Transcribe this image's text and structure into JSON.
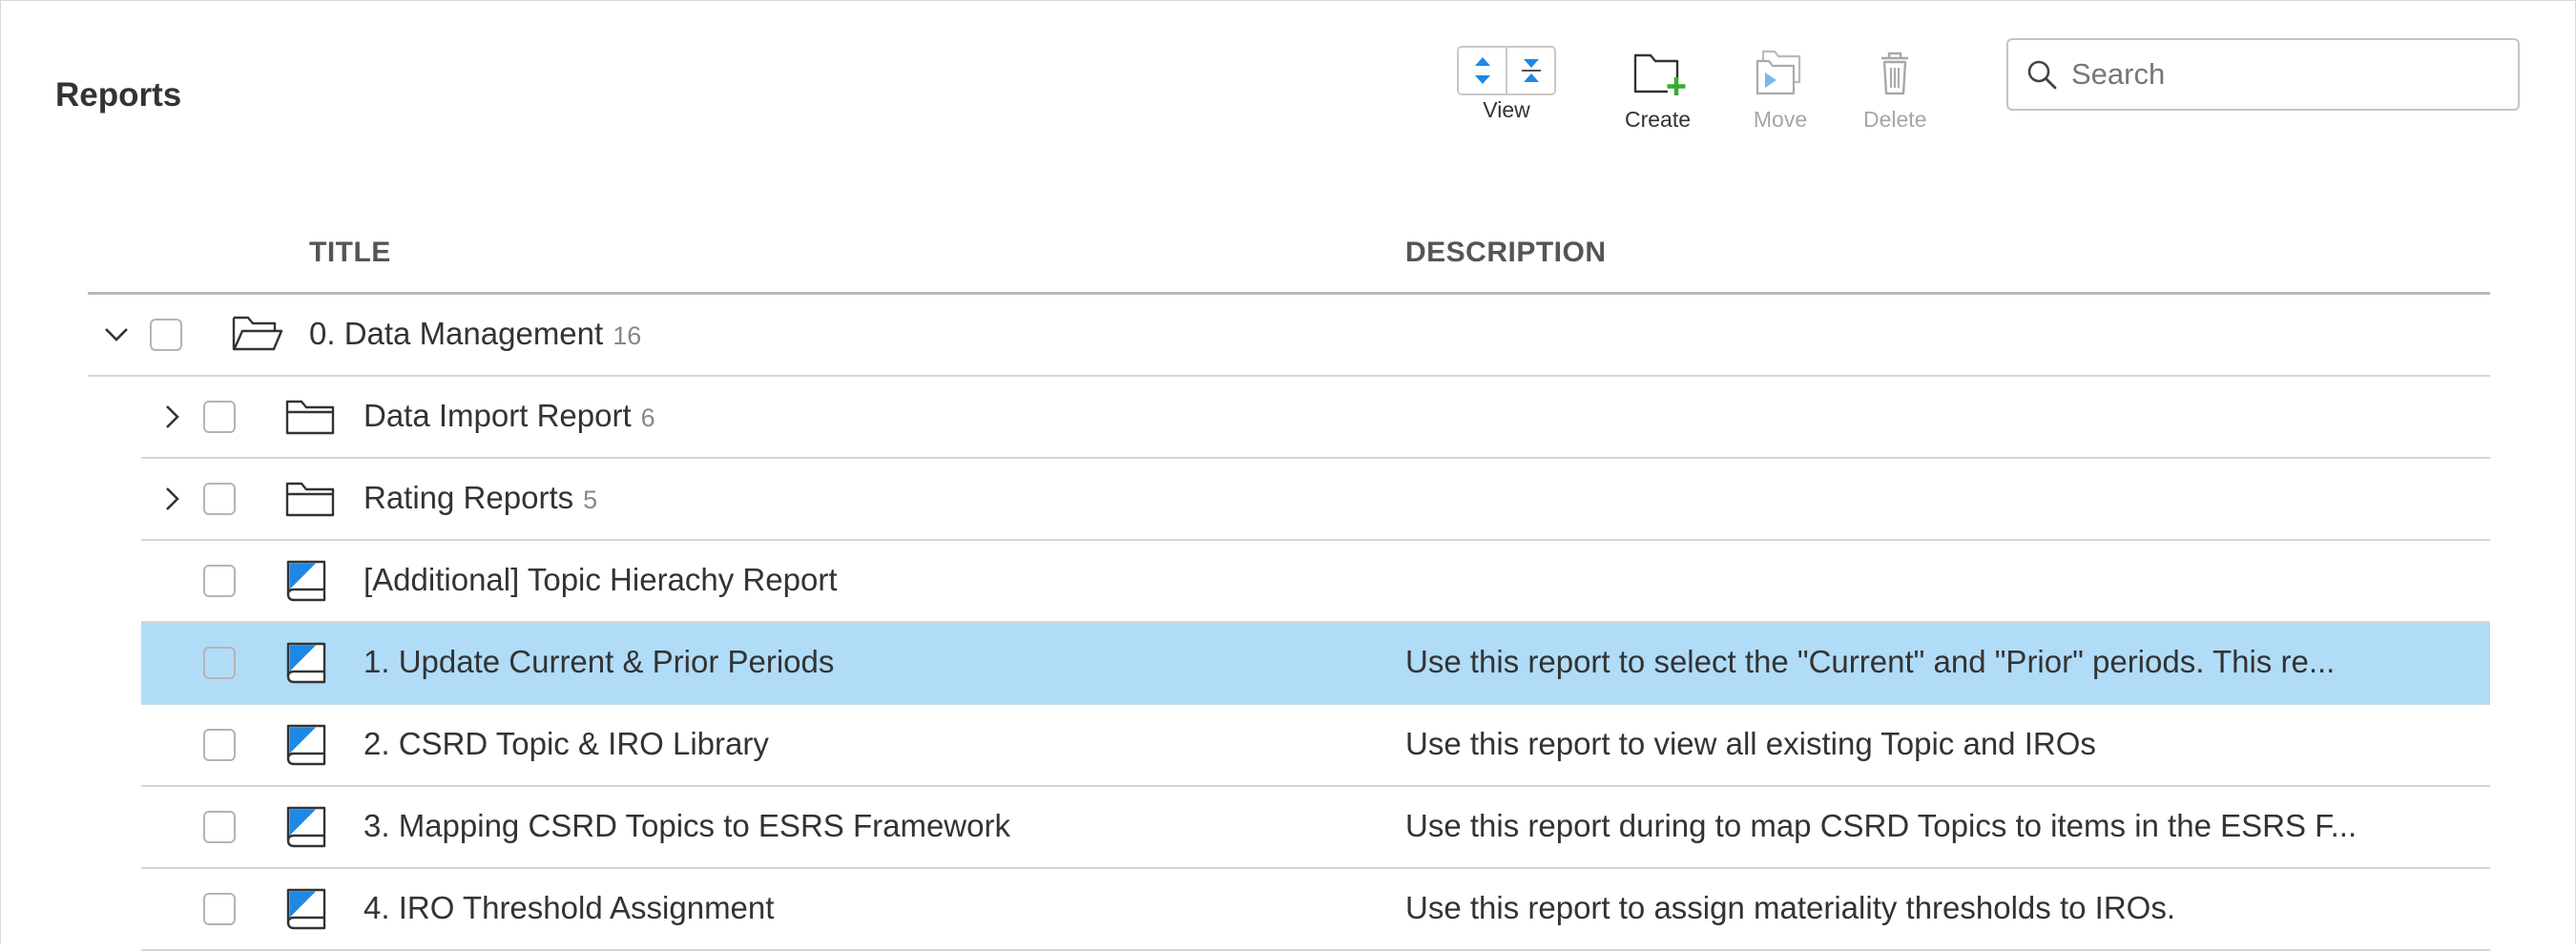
{
  "page": {
    "title": "Reports"
  },
  "toolbar": {
    "view_label": "View",
    "create_label": "Create",
    "move_label": "Move",
    "delete_label": "Delete"
  },
  "search": {
    "placeholder": "Search",
    "value": ""
  },
  "columns": {
    "title": "TITLE",
    "description": "DESCRIPTION"
  },
  "colors": {
    "selected_row": "#b0dcf8",
    "accent_blue": "#1e88e5",
    "create_green": "#3aaa35"
  },
  "rows": [
    {
      "type": "folder",
      "expanded": true,
      "title": "0. Data Management",
      "count": "16",
      "description": ""
    },
    {
      "type": "folder",
      "expanded": false,
      "title": "Data Import Report",
      "count": "6",
      "description": ""
    },
    {
      "type": "folder",
      "expanded": false,
      "title": "Rating Reports",
      "count": "5",
      "description": ""
    },
    {
      "type": "report",
      "title": "[Additional] Topic Hierachy Report",
      "description": ""
    },
    {
      "type": "report",
      "selected": true,
      "title": "1. Update Current & Prior Periods",
      "description": "Use this report to select the \"Current\" and \"Prior\" periods. This re..."
    },
    {
      "type": "report",
      "title": "2. CSRD Topic & IRO Library",
      "description": "Use this report to view all existing Topic and IROs"
    },
    {
      "type": "report",
      "title": "3. Mapping CSRD Topics to ESRS Framework",
      "description": "Use this report during to map CSRD Topics to items in the ESRS F..."
    },
    {
      "type": "report",
      "title": "4. IRO Threshold Assignment",
      "description": "Use this report to assign materiality thresholds to IROs."
    }
  ]
}
